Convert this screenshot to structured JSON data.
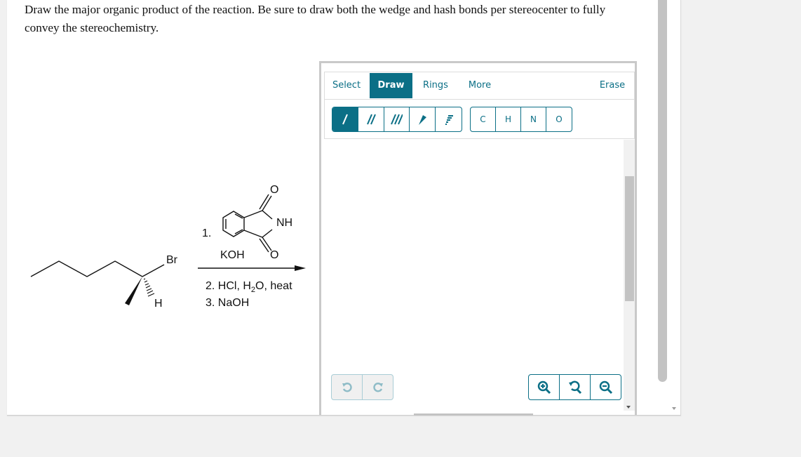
{
  "question": {
    "prompt": "Draw the major organic product of the reaction. Be sure to draw both the wedge and hash bonds per stereocenter to fully convey the stereochemistry."
  },
  "reaction": {
    "substituent_label": "Br",
    "hydrogen_label": "H",
    "step1_number": "1.",
    "reagent1_base": "KOH",
    "phthalimide_nh": "NH",
    "phthalimide_o_top": "O",
    "phthalimide_o_bottom": "O",
    "step2": "2. HCl, H",
    "step2_sub": "2",
    "step2_tail": "O, heat",
    "step3": "3. NaOH"
  },
  "editor": {
    "tabs": [
      {
        "label": "Select",
        "active": false
      },
      {
        "label": "Draw",
        "active": true
      },
      {
        "label": "Rings",
        "active": false
      },
      {
        "label": "More",
        "active": false
      },
      {
        "label": "Erase",
        "active": false
      }
    ],
    "bond_tools": [
      {
        "name": "single-bond-icon",
        "active": true
      },
      {
        "name": "double-bond-icon",
        "active": false
      },
      {
        "name": "triple-bond-icon",
        "active": false
      },
      {
        "name": "wedge-bond-icon",
        "active": false
      },
      {
        "name": "hash-bond-icon",
        "active": false
      }
    ],
    "atom_tools": [
      "C",
      "H",
      "N",
      "O"
    ],
    "history": [
      "undo-icon",
      "redo-icon"
    ],
    "zoom_controls": [
      "zoom-in-icon",
      "reset-zoom-icon",
      "zoom-out-icon"
    ],
    "accent_color": "#0b6f86"
  }
}
